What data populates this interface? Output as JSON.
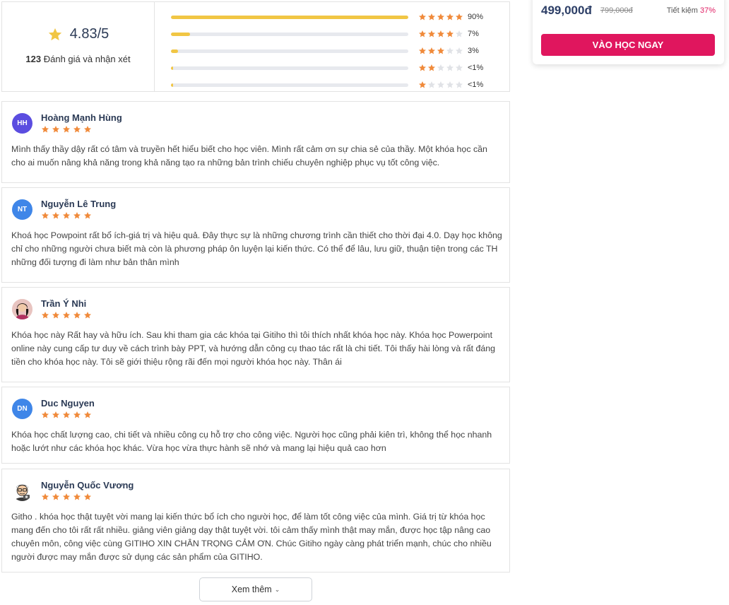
{
  "summary": {
    "average": "4.83/5",
    "count": "123",
    "count_label": "Đánh giá và nhận xét",
    "distribution": [
      {
        "stars": 5,
        "fraction": 1.0,
        "label": "90%"
      },
      {
        "stars": 4,
        "fraction": 0.08,
        "label": "7%"
      },
      {
        "stars": 3,
        "fraction": 0.03,
        "label": "3%"
      },
      {
        "stars": 2,
        "fraction": 0.01,
        "label": "<1%"
      },
      {
        "stars": 1,
        "fraction": 0.01,
        "label": "<1%"
      }
    ]
  },
  "price_card": {
    "price": "499,000đ",
    "old_price": "799,000đ",
    "saving_label": "Tiết kiệm",
    "saving_pct": "37%",
    "cta": "VÀO HỌC NGAY"
  },
  "colors": {
    "star_on": "#f08a3a",
    "star_off": "#e0e2e6",
    "bar_fill": "#f1c644",
    "accent": "#e0165e"
  },
  "reviews": [
    {
      "initials": "HH",
      "avatar_color": "#5b4de0",
      "name": "Hoàng Mạnh Hùng",
      "stars": 5,
      "text": "Mình thấy thầy dậy rất có tâm và truyền hết hiểu biết cho học viên. Mình rất cảm ơn sự chia sẻ của thầy. Một khóa học cần cho ai muốn nâng khả năng trong khả năng tạo ra những bản trình chiếu chuyên nghiệp phục vụ tốt công việc."
    },
    {
      "initials": "NT",
      "avatar_color": "#3f86e8",
      "name": "Nguyễn Lê Trung",
      "stars": 5,
      "text": "Khoá học Powpoint rất bổ ích-giá trị và hiệu quả. Đây thực sự là những chương trình cần thiết cho thời đại 4.0. Dạy học không chỉ cho những người chưa biết mà còn là phương pháp ôn luyện lại kiến thức. Có thể để lâu, lưu giữ, thuận tiện trong các TH những đối tượng đi làm như bản thân mình"
    },
    {
      "initials": "",
      "avatar_color": "photo",
      "name": "Trần Ý Nhi",
      "stars": 5,
      "text": "Khóa học này Rất hay và hữu ích. Sau khi tham gia các khóa tại Gitiho thì tôi thích nhất khóa học này. Khóa học Powerpoint online này cung cấp tư duy về cách trình bày PPT, và hướng dẫn công cụ thao tác rất là chi tiết. Tôi thấy hài lòng và rất đáng tiền cho khóa học này. Tôi sẽ giới thiệu rộng rãi đến mọi người khóa học này. Thân ái"
    },
    {
      "initials": "DN",
      "avatar_color": "#3f86e8",
      "name": "Duc Nguyen",
      "stars": 5,
      "text": "Khóa học chất lượng cao, chi tiết và nhiều công cụ hỗ trợ cho công việc. Người học cũng phải kiên trì, không thể học nhanh hoặc lướt như các khóa học khác. Vừa học vừa thực hành sẽ nhớ và mang lại hiệu quả cao hơn"
    },
    {
      "initials": "",
      "avatar_color": "cartoon",
      "name": "Nguyễn Quốc Vương",
      "stars": 5,
      "text": "Githo . khóa học thật tuyệt vời mang lại kiến thức bổ ích cho người học, để làm tốt công việc của mình. Giá trị từ khóa học mang đến cho tôi rất rất nhiều. giảng viên giảng dạy thật tuyệt vời. tôi cảm thấy mình thật may mắn, được học tập nâng cao chuyên môn, công việc cùng GITIHO XIN CHÂN TRỌNG CẢM ƠN. Chúc Gitiho ngày càng phát triển mạnh, chúc cho nhiều người được may mắn được sử dụng các sản phẩm của GITIHO."
    }
  ],
  "more_button": {
    "label": "Xem thêm",
    "icon": "chevron-down-icon"
  }
}
